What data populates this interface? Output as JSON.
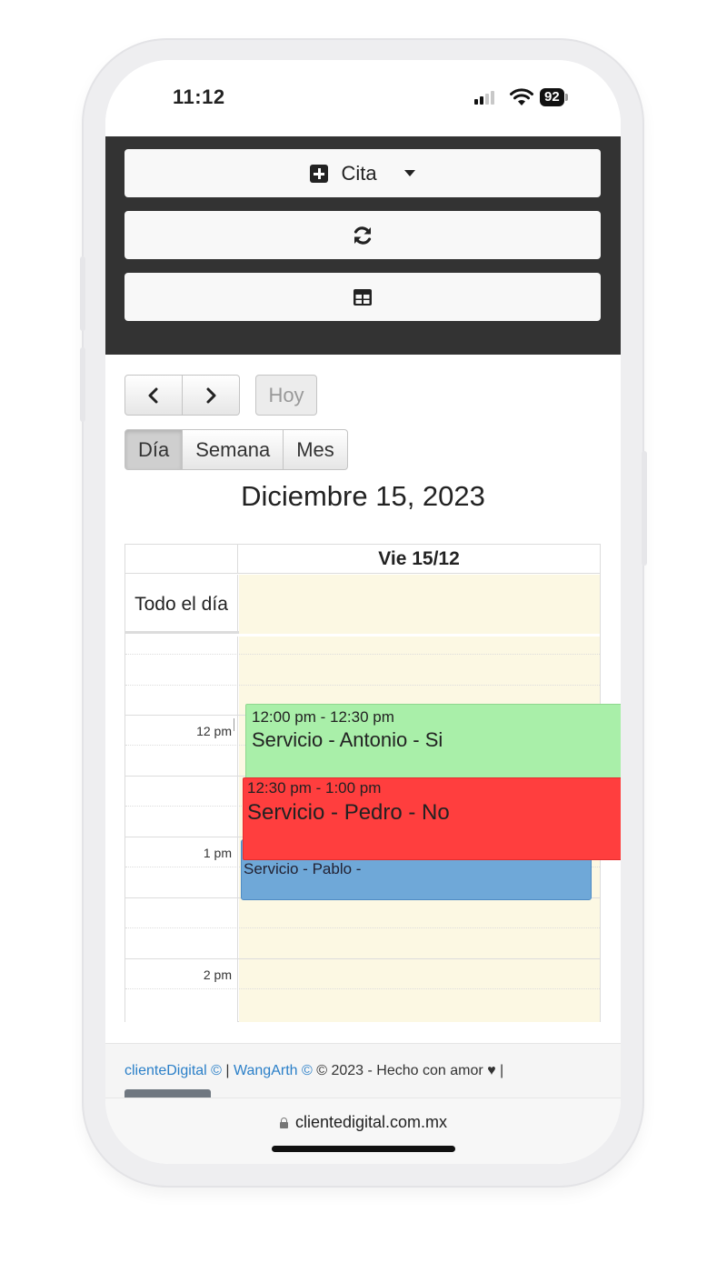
{
  "status_bar": {
    "time": "11:12",
    "battery": "92",
    "icons": [
      "signal-icon",
      "wifi-icon",
      "battery-icon"
    ]
  },
  "toolbar": {
    "new_appointment_label": "Cita",
    "icons": [
      "plus-square-icon",
      "caret-down-icon",
      "refresh-icon",
      "table-icon"
    ]
  },
  "calendar": {
    "prev_icon": "‹",
    "next_icon": "›",
    "today_label": "Hoy",
    "views": [
      "Día",
      "Semana",
      "Mes"
    ],
    "active_view": "Día",
    "title": "Diciembre 15, 2023",
    "day_header": "Vie 15/12",
    "all_day_label": "Todo el día",
    "hour_labels": [
      "12 pm",
      "1 pm",
      "2 pm"
    ],
    "colors": {
      "slot_background": "#fcf8e3",
      "event_green": "#a9efa9",
      "event_red": "#ff3e3e",
      "event_blue": "#6fa8d8"
    },
    "events": [
      {
        "time": "12:00 pm - 12:30 pm",
        "title": "Servicio - Antonio - Si",
        "color": "green"
      },
      {
        "time": "12:30 pm - 1:00 pm",
        "title": "Servicio - Pedro - No",
        "color": "red"
      },
      {
        "time": "",
        "title": "Servicio - Pablo -",
        "color": "blue"
      }
    ]
  },
  "footer": {
    "link1": "clienteDigital ©",
    "sep1": " | ",
    "link2": "WangArth ©",
    "rest": " © 2023 - Hecho con amor ♥ |"
  },
  "browser": {
    "url": "clientedigital.com.mx"
  }
}
